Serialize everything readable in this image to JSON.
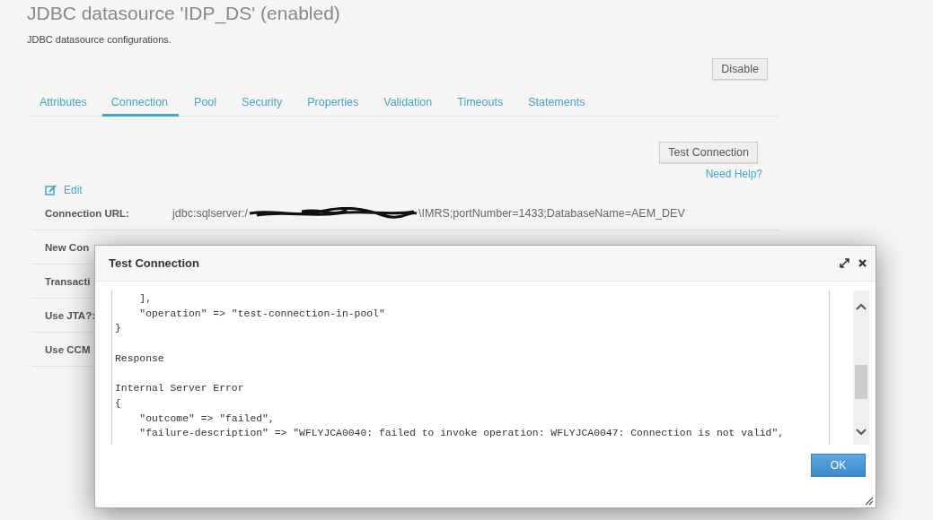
{
  "page": {
    "title": "JDBC datasource 'IDP_DS' (enabled)",
    "subtitle": "JDBC datasource configurations.",
    "disable_button": "Disable"
  },
  "tabs": [
    {
      "label": "Attributes",
      "selected": false
    },
    {
      "label": "Connection",
      "selected": true
    },
    {
      "label": "Pool",
      "selected": false
    },
    {
      "label": "Security",
      "selected": false
    },
    {
      "label": "Properties",
      "selected": false
    },
    {
      "label": "Validation",
      "selected": false
    },
    {
      "label": "Timeouts",
      "selected": false
    },
    {
      "label": "Statements",
      "selected": false
    }
  ],
  "test_button": "Test Connection",
  "help_link": "Need Help?",
  "edit_link": "Edit",
  "fields": [
    {
      "label": "Connection URL:",
      "value_start": "jdbc:sqlserver:/",
      "value_end": "\\IMRS;portNumber=1433;DatabaseName=AEM_DEV"
    },
    {
      "label": "New Con"
    },
    {
      "label": "Transacti"
    },
    {
      "label": "Use JTA?:"
    },
    {
      "label": "Use CCM"
    }
  ],
  "dialog": {
    "title": "Test Connection",
    "log_text": "    ],\n    \"operation\" => \"test-connection-in-pool\"\n}\n\nResponse\n\nInternal Server Error\n{\n    \"outcome\" => \"failed\",\n    \"failure-description\" => \"WFLYJCA0040: failed to invoke operation: WFLYJCA0047: Connection is not valid\",",
    "ok_button": "OK"
  }
}
